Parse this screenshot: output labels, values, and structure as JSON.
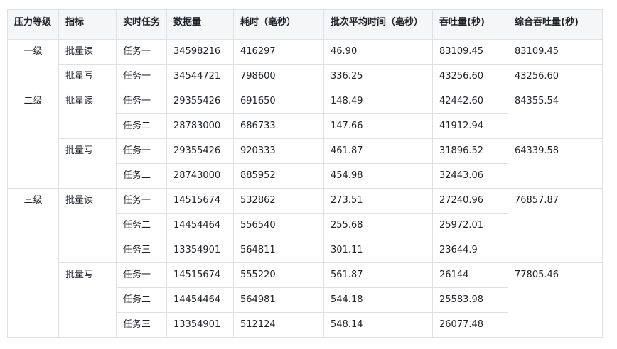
{
  "headers": [
    "压力等级",
    "指标",
    "实时任务",
    "数据量",
    "耗时（毫秒）",
    "批次平均时间（毫秒）",
    "吞吐量(秒)",
    "综合吞吐量(秒)"
  ],
  "levels": {
    "l1": "一级",
    "l2": "二级",
    "l3": "三级"
  },
  "metrics": {
    "read": "批量读",
    "write": "批量写"
  },
  "rows": [
    {
      "task": "任务一",
      "size": "34598216",
      "time": "416297",
      "avg": "46.90",
      "tput": "83109.45",
      "combined": "83109.45"
    },
    {
      "task": "任务一",
      "size": "34544721",
      "time": "798600",
      "avg": "336.25",
      "tput": "43256.60",
      "combined": "43256.60"
    },
    {
      "task": "任务一",
      "size": "29355426",
      "time": "691650",
      "avg": "148.49",
      "tput": "42442.60",
      "combined": "84355.54"
    },
    {
      "task": "任务二",
      "size": "28783000",
      "time": "686733",
      "avg": "147.66",
      "tput": "41912.94"
    },
    {
      "task": "任务一",
      "size": "29355426",
      "time": "920333",
      "avg": "461.87",
      "tput": "31896.52",
      "combined": "64339.58"
    },
    {
      "task": "任务二",
      "size": "28743000",
      "time": "885952",
      "avg": "454.98",
      "tput": "32443.06"
    },
    {
      "task": "任务一",
      "size": "14515674",
      "time": "532862",
      "avg": "273.51",
      "tput": "27240.96",
      "combined": "76857.87"
    },
    {
      "task": "任务二",
      "size": "14454464",
      "time": "556540",
      "avg": "255.68",
      "tput": "25972.01"
    },
    {
      "task": "任务三",
      "size": "13354901",
      "time": "564811",
      "avg": "301.11",
      "tput": "23644.9"
    },
    {
      "task": "任务一",
      "size": "14515674",
      "time": "555220",
      "avg": "561.87",
      "tput": "26144",
      "combined": "77805.46"
    },
    {
      "task": "任务二",
      "size": "14454464",
      "time": "564981",
      "avg": "544.18",
      "tput": "25583.98"
    },
    {
      "task": "任务三",
      "size": "13354901",
      "time": "512124",
      "avg": "548.14",
      "tput": "26077.48"
    }
  ]
}
